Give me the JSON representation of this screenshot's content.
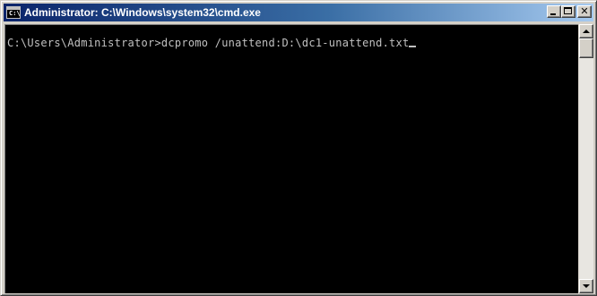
{
  "window": {
    "title": "Administrator: C:\\Windows\\system32\\cmd.exe",
    "icon": "cmd-icon",
    "icon_text": "C:\\",
    "caption_buttons": {
      "minimize": "minimize-icon",
      "maximize": "maximize-icon",
      "close": "✕"
    }
  },
  "console": {
    "background": "#000000",
    "foreground": "#c0c0c0",
    "line": "C:\\Users\\Administrator>dcpromo /unattend:D:\\dc1-unattend.txt"
  },
  "scrollbar": {
    "up_icon": "arrow-up-icon",
    "down_icon": "arrow-down-icon"
  }
}
